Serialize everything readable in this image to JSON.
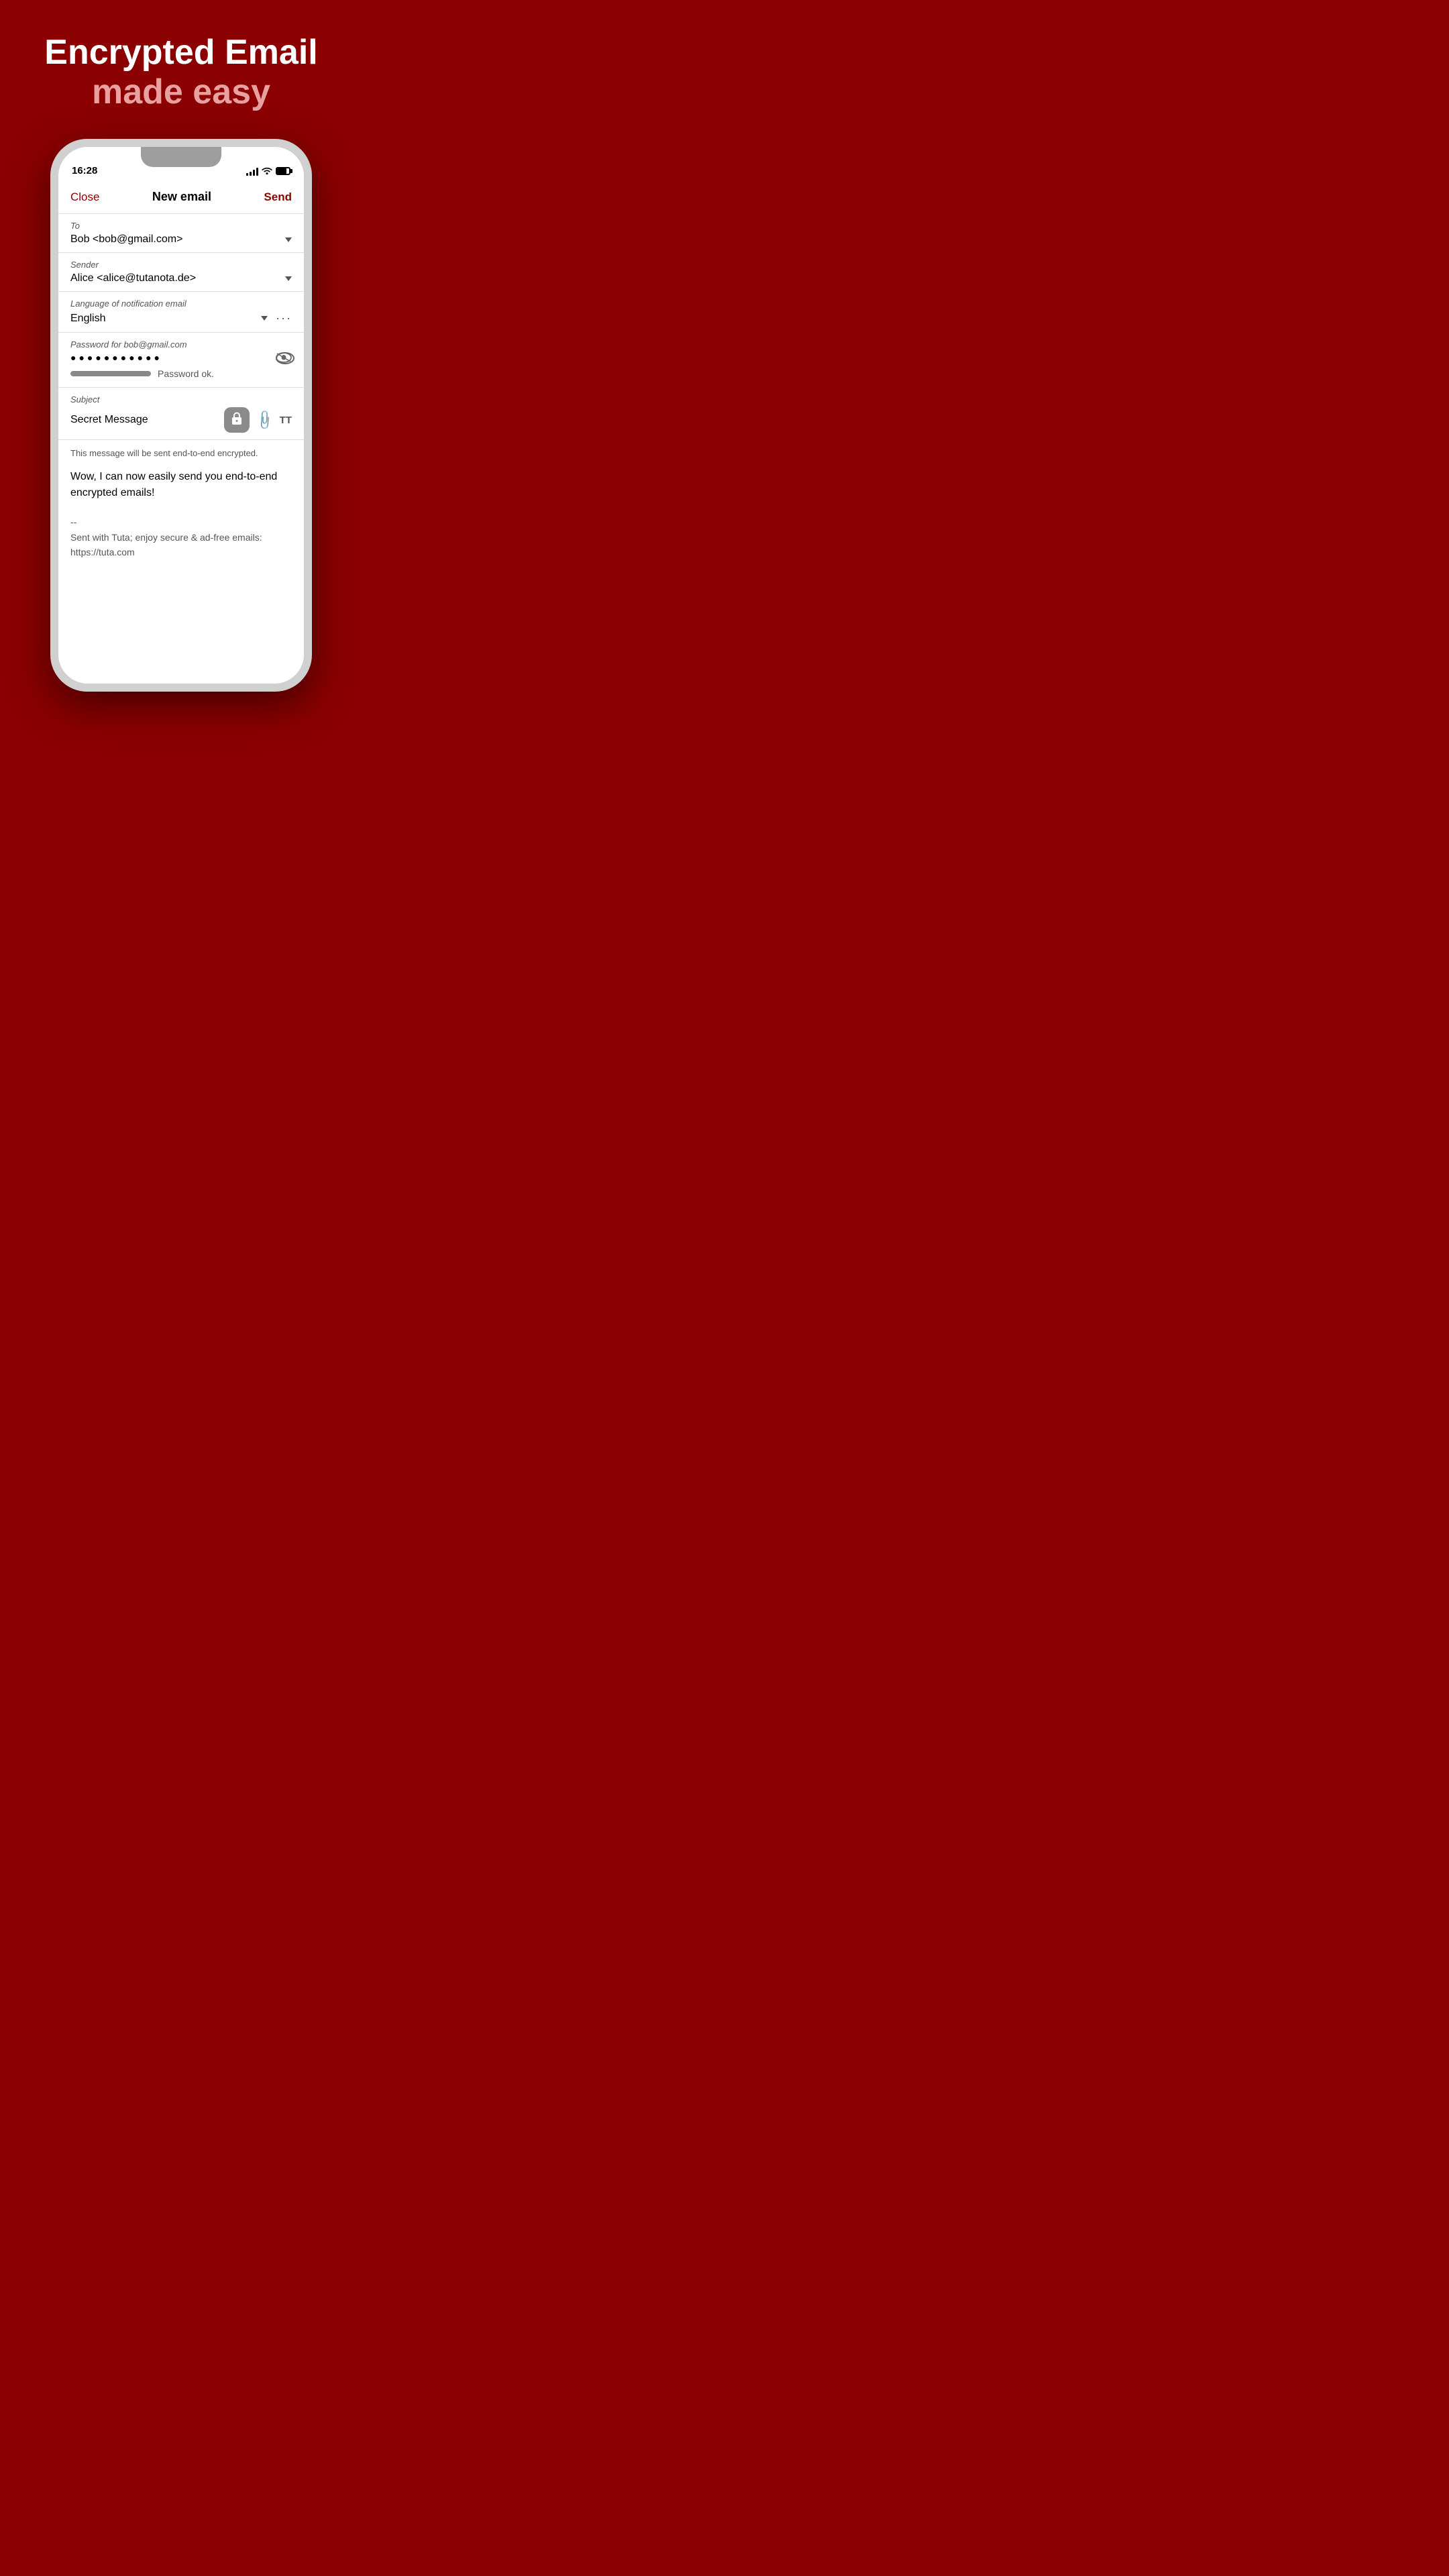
{
  "hero": {
    "title": "Encrypted Email",
    "subtitle": "made easy"
  },
  "statusBar": {
    "time": "16:28",
    "signalBars": [
      4,
      6,
      8,
      10,
      12
    ],
    "batteryLevel": "80%"
  },
  "navbar": {
    "close": "Close",
    "title": "New email",
    "send": "Send"
  },
  "fields": {
    "to": {
      "label": "To",
      "value": "Bob <bob@gmail.com>"
    },
    "sender": {
      "label": "Sender",
      "value": "Alice <alice@tutanota.de>"
    },
    "language": {
      "label": "Language of notification email",
      "value": "English"
    },
    "password": {
      "label": "Password for bob@gmail.com",
      "value": "●●●●●●●●●●●",
      "status": "Password ok."
    },
    "subject": {
      "label": "Subject",
      "value": "Secret Message"
    }
  },
  "body": {
    "encryptionNotice": "This message will be sent end-to-end encrypted.",
    "content": "Wow, I can now easily send you end-to-end encrypted emails!",
    "signature": "--\nSent with Tuta; enjoy secure & ad-free emails:\nhttps://tuta.com"
  },
  "colors": {
    "brand": "#8B0000",
    "brandLight": "#e8a0a0"
  }
}
